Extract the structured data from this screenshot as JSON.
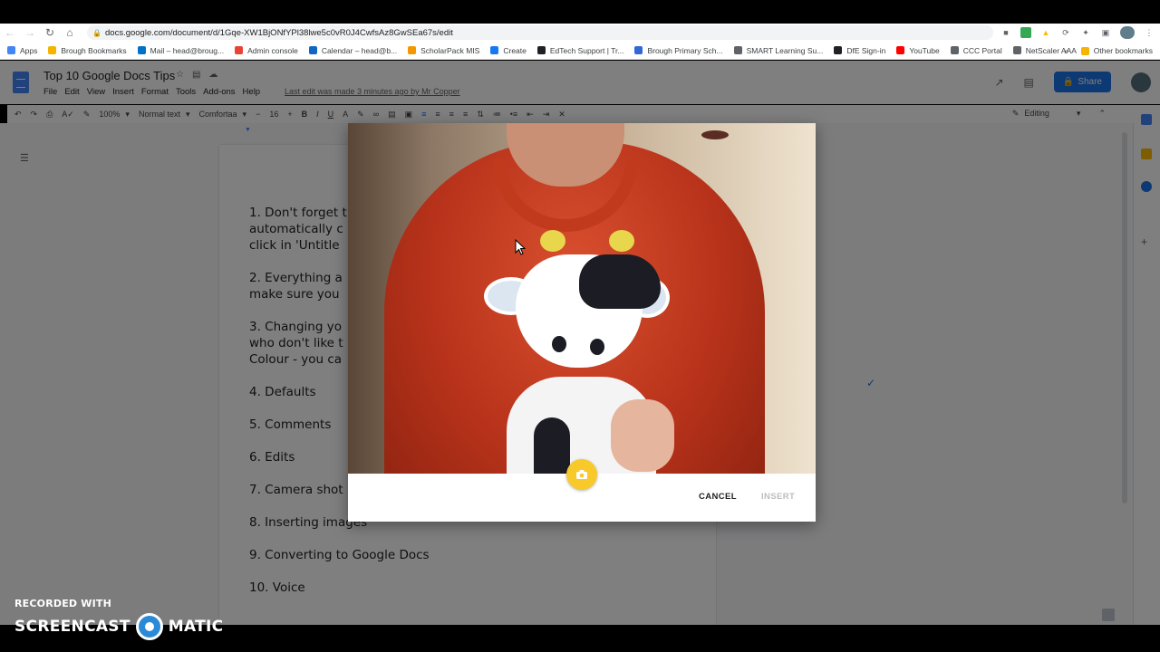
{
  "browser": {
    "url": "docs.google.com/document/d/1Gqe-XW1BjONfYPl38lwe5c0vR0J4CwfsAz8GwSEa67s/edit",
    "bookmarks": [
      {
        "label": "Apps",
        "color": "#4285f4"
      },
      {
        "label": "Brough Bookmarks",
        "color": "#f4b400"
      },
      {
        "label": "Mail – head@broug...",
        "color": "#0072c6"
      },
      {
        "label": "Admin console",
        "color": "#ea4335"
      },
      {
        "label": "Calendar – head@b...",
        "color": "#0f67c3"
      },
      {
        "label": "ScholarPack MIS",
        "color": "#f29900"
      },
      {
        "label": "Create",
        "color": "#1877f2"
      },
      {
        "label": "EdTech Support | Tr...",
        "color": "#202124"
      },
      {
        "label": "Brough Primary Sch...",
        "color": "#3367d6"
      },
      {
        "label": "SMART Learning Su...",
        "color": "#5f6368"
      },
      {
        "label": "DfE Sign-in",
        "color": "#202124"
      },
      {
        "label": "YouTube",
        "color": "#ff0000"
      },
      {
        "label": "CCC Portal",
        "color": "#5f6368"
      },
      {
        "label": "NetScaler AAA",
        "color": "#5f6368"
      }
    ],
    "other_bookmarks": "Other bookmarks",
    "overflow": "»"
  },
  "docs": {
    "title": "Top 10 Google Docs Tips",
    "menu": [
      "File",
      "Edit",
      "View",
      "Insert",
      "Format",
      "Tools",
      "Add-ons",
      "Help"
    ],
    "last_edit": "Last edit was made 3 minutes ago by Mr Copper",
    "share_label": "Share",
    "toolbar": {
      "zoom": "100%",
      "style": "Normal text",
      "font": "Comfortaa",
      "size": "16",
      "mode": "Editing"
    },
    "list_items": [
      "1. Don't forget t",
      "automatically c",
      "click in 'Untitle",
      "2. Everything a",
      "make sure you",
      "3. Changing yo",
      "who don't like t",
      "Colour - you ca",
      "4. Defaults",
      "5. Comments",
      "6. Edits",
      "7. Camera shot",
      "8. Inserting images",
      "9. Converting to Google Docs",
      "10. Voice"
    ]
  },
  "dialog": {
    "cancel_label": "CANCEL",
    "insert_label": "INSERT",
    "shutter_icon": "camera-icon"
  },
  "watermark": {
    "recorded": "RECORDED WITH",
    "brand_left": "SCREENCAST",
    "brand_right": "MATIC"
  },
  "colors": {
    "accent": "#1a73e8",
    "shutter": "#f8c92b",
    "docs_blue": "#4285f4"
  }
}
